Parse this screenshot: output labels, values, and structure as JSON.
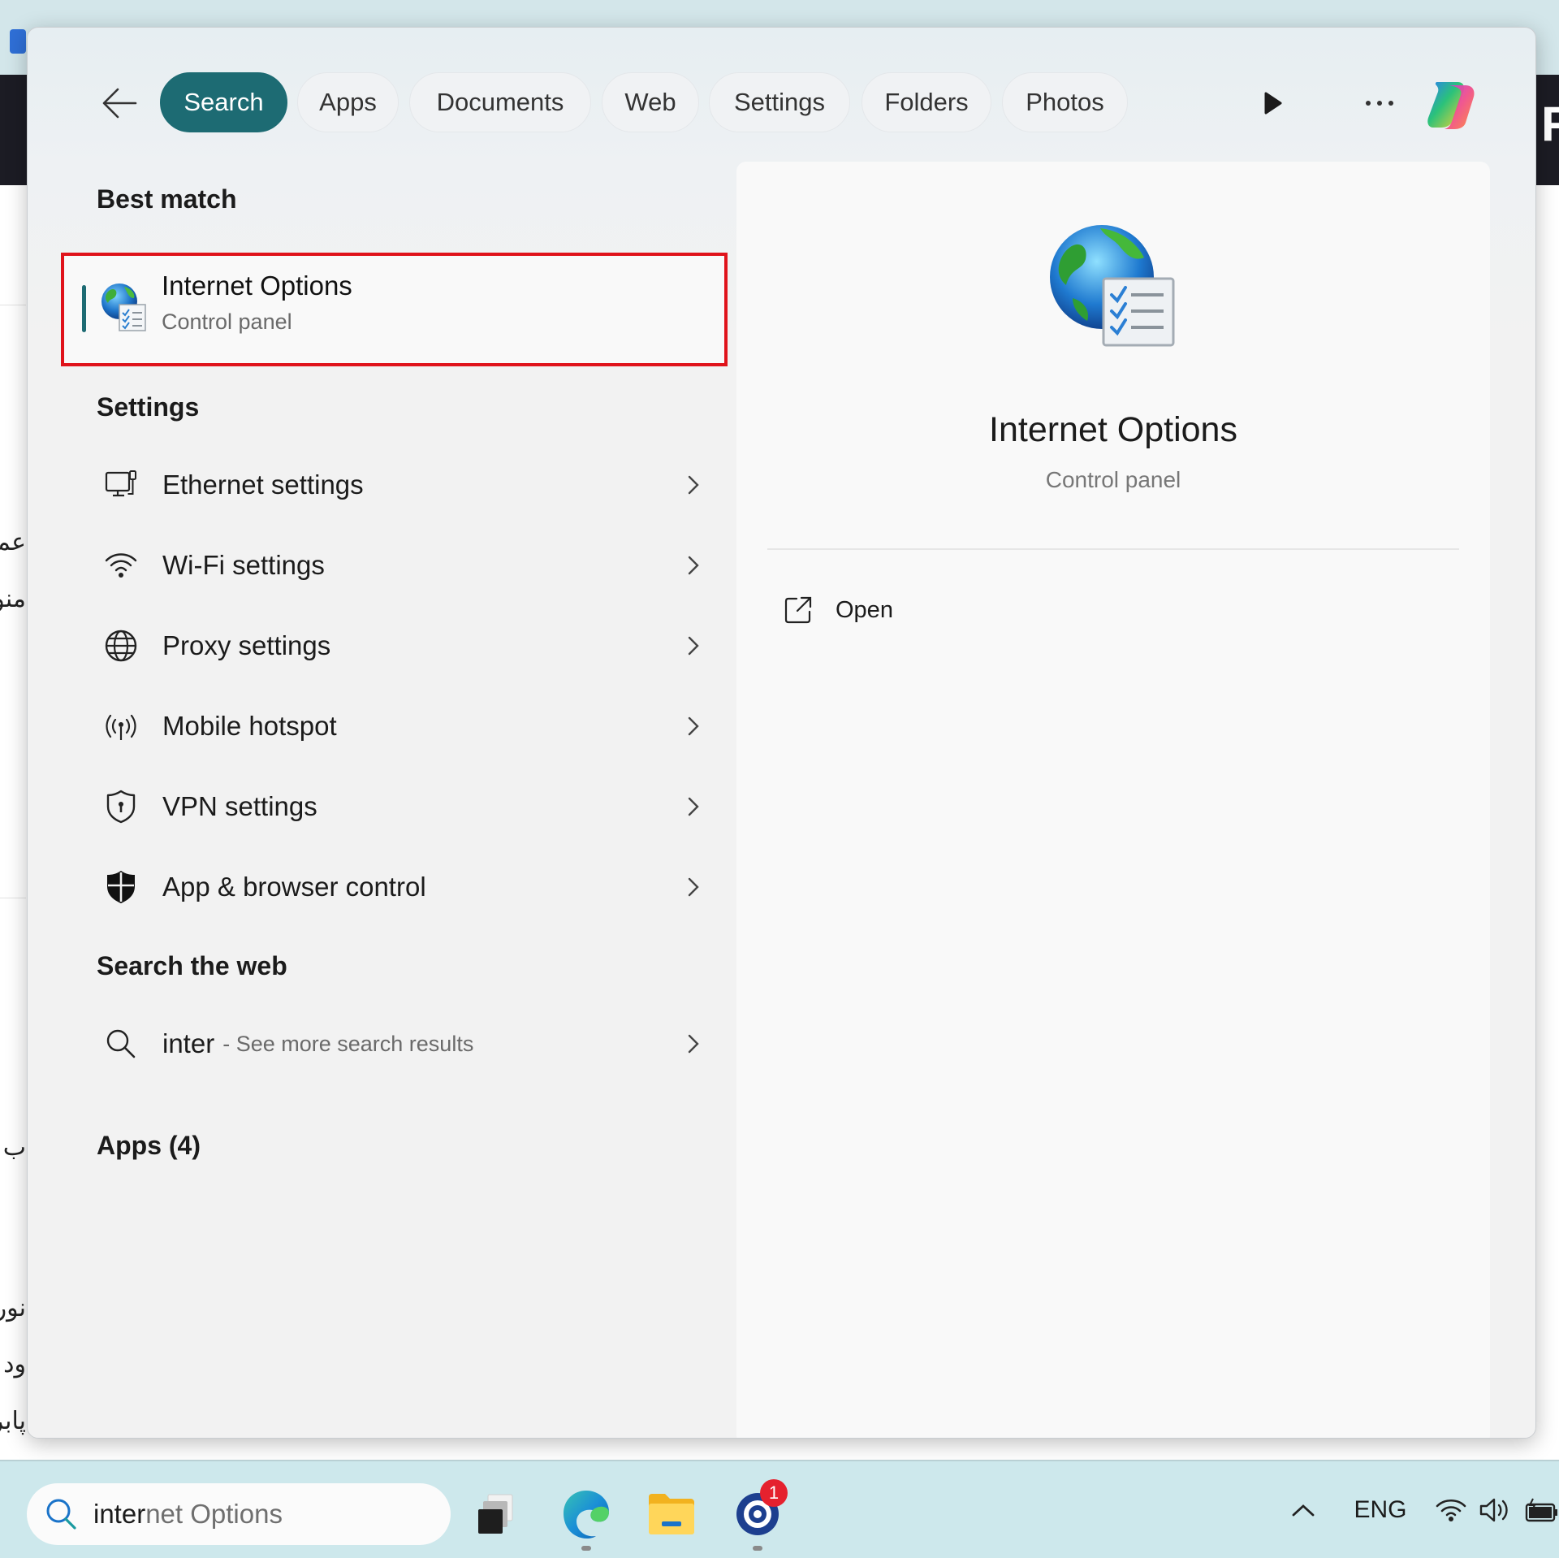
{
  "background": {
    "rtl_fragments": [
      "عم",
      "منو",
      "ب ،",
      "نور",
      "ود",
      "پابر"
    ],
    "right_glyph": "F"
  },
  "header": {
    "back_label": "Back",
    "tabs": [
      {
        "label": "Search",
        "active": true
      },
      {
        "label": "Apps",
        "active": false
      },
      {
        "label": "Documents",
        "active": false
      },
      {
        "label": "Web",
        "active": false
      },
      {
        "label": "Settings",
        "active": false
      },
      {
        "label": "Folders",
        "active": false
      },
      {
        "label": "Photos",
        "active": false
      }
    ],
    "icons": [
      "play-icon",
      "more-options-icon",
      "copilot-icon"
    ]
  },
  "results": {
    "best_match": {
      "section": "Best match",
      "title": "Internet Options",
      "subtitle": "Control panel",
      "icon": "internet-options-icon",
      "highlight_color": "#e0131b"
    },
    "settings": {
      "section": "Settings",
      "items": [
        {
          "label": "Ethernet settings",
          "icon": "ethernet-icon"
        },
        {
          "label": "Wi-Fi settings",
          "icon": "wifi-icon"
        },
        {
          "label": "Proxy settings",
          "icon": "globe-icon"
        },
        {
          "label": "Mobile hotspot",
          "icon": "hotspot-icon"
        },
        {
          "label": "VPN settings",
          "icon": "vpn-shield-icon"
        },
        {
          "label": "App & browser control",
          "icon": "security-shield-icon"
        }
      ]
    },
    "web": {
      "section": "Search the web",
      "query": "inter",
      "suffix": "- See more search results"
    },
    "apps": {
      "section": "Apps (4)"
    }
  },
  "preview": {
    "title": "Internet Options",
    "subtitle": "Control panel",
    "actions": [
      {
        "label": "Open",
        "icon": "open-external-icon"
      }
    ]
  },
  "taskbar": {
    "search_typed": "inter",
    "search_completion": "net Options",
    "apps": [
      {
        "name": "task-view",
        "running": false
      },
      {
        "name": "edge",
        "running": true
      },
      {
        "name": "file-explorer",
        "running": false
      },
      {
        "name": "app-with-badge",
        "running": true,
        "badge": "1"
      }
    ],
    "tray": {
      "language": "ENG"
    }
  },
  "colors": {
    "accent": "#1d6b73",
    "highlight": "#e0131b",
    "badge": "#e5212e"
  }
}
